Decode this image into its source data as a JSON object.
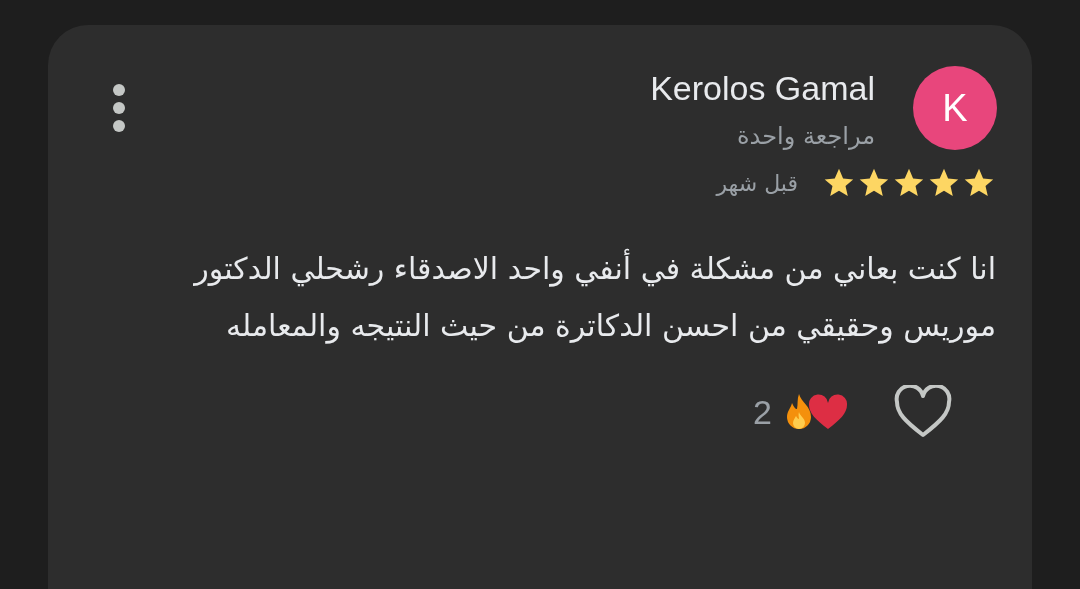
{
  "review": {
    "avatar_letter": "K",
    "author": "Kerolos Gamal",
    "author_meta": "مراجعة واحدة",
    "stars": 5,
    "time": "قبل شهر",
    "text": "انا كنت بعاني من مشكلة في أنفي واحد الاصدقاء رشحلي الدكتور موريس وحقيقي من احسن الدكاترة من حيث النتيجه والمعامله",
    "reaction_count": "2",
    "liked": false
  }
}
